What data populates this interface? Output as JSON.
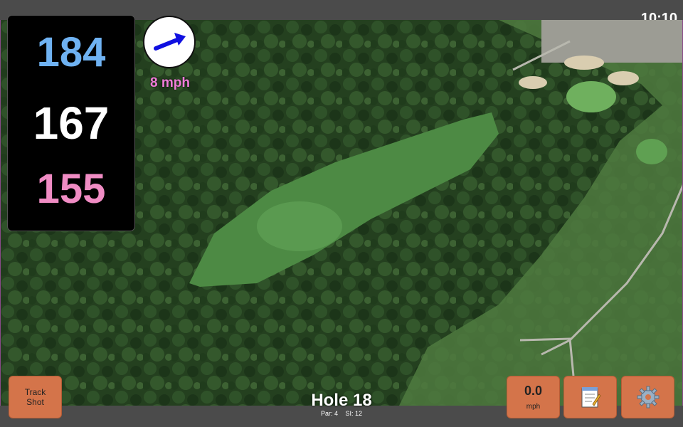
{
  "status": {
    "time": "10:10"
  },
  "yardage": {
    "back": "184",
    "middle": "167",
    "front": "155"
  },
  "wind": {
    "speed": "8 mph",
    "icon": "wind-direction-arrow-icon",
    "arrow_color": "#1010e0"
  },
  "hole": {
    "title": "Hole 18",
    "par": "Par: 4",
    "si": "SI: 12"
  },
  "buttons": {
    "track_shot": "Track\nShot",
    "speed_value": "0.0",
    "speed_unit": "mph",
    "notes_icon": "scorecard-notepad-icon",
    "settings_icon": "gear-icon"
  },
  "colors": {
    "button_bg": "#d4744a",
    "back_yardage": "#6fb2f2",
    "front_yardage": "#f08cc4",
    "wind_text": "#f07cd8"
  }
}
